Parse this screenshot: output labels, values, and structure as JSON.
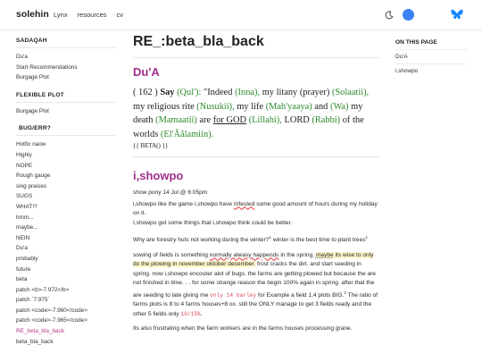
{
  "header": {
    "brand": "solehin",
    "nav": [
      "Lynx",
      "resources",
      "cv"
    ],
    "accent": "#3b82f6"
  },
  "sidebar": {
    "groups": [
      {
        "title": "SADAQAH",
        "items": [
          "Du'a",
          "Start Recommendations",
          "Burgage Plot"
        ]
      },
      {
        "title": "FLEXIBLE PLOT",
        "items": [
          "Burgage Plot"
        ]
      },
      {
        "title": "BUG/ERR?",
        "items": [
          "Hotfix naow",
          "Highly",
          "NOPE",
          "Rough gauge",
          "sing praises",
          "SUGS",
          "WHAT!?",
          "hmm...",
          "maybe...",
          "NEIN",
          "Du'a",
          "probably",
          "future",
          "beta",
          "patch <b>-7.972</b>",
          "patch `7.975`",
          "patch <code>-7.960</code>",
          "patch <code>-7.965</code>",
          "RE_beta_bla_back",
          "beta_bla_back"
        ]
      }
    ],
    "active_item": "RE_beta_bla_back",
    "active_color": "#b5348a"
  },
  "main": {
    "title": "RE_:beta_bla_back",
    "section1": {
      "heading": "Du'A",
      "verse": {
        "num": "( 162 )",
        "say": "Say",
        "qul": "(Qul'):",
        "t1": "\"Indeed",
        "inna": "(Inna),",
        "t2": "my litany (prayer)",
        "solaatii": "(Solaatii),",
        "t3": "my religious rite",
        "nusukii": "(Nusukii),",
        "t4": "my life",
        "mahyaaya": "(Mah'yaaya)",
        "t5": "and",
        "wa": "(Wa)",
        "t6": "my death",
        "mamaatii": "(Mamaatii)",
        "t7": "are",
        "forgod": "for GOD",
        "lillahi": "(Lillahi),",
        "t8": "LORD",
        "rabbi": "(Rabbi)",
        "t9": "of the worlds",
        "alamiin": "(El'Ãâlamiin).",
        "ref": "{{ BETA() }}"
      }
    },
    "section2": {
      "heading": "i,showpo",
      "meta": "show pony 14 Jul @ 6:05pm",
      "p1a": "i,showpo like the game i,showpo have",
      "p1b": "Infested",
      "p1c": "some good amount of hours during my holiday on it.",
      "p1d": "I,showpo got some things that i,showpo think could be better.",
      "p2a": "Why are forestry huts not working during the winter?",
      "fn1": "1",
      "p2b": "winter is the best time to plant trees",
      "fn2": "1",
      "p3a": "sowing of fields is something",
      "p3b": "normally alwasy happends",
      "p3c": "in the spring.",
      "p3d": "maybe",
      "p3e": "its wise to only do the plowing in november oktober december.",
      "p3f": "frost cracks the dirt. and start seeding in spring. now i,showpo encouter alot of bugs. the farms are getting plowed but because the are not finished in time. . . for some strange reason the begin 100% again in spring. after that the are seeding to late giving me",
      "code1": "only 14 barley",
      "p3g": "for Example a field 1,4 plots BIG.",
      "fn3": "2",
      "p3h": "The ratio of farms plots is 8 to 4 farms houses+8 ox. still the ONLY manage to get 3 fields ready and the other 5 fields only",
      "code2": "10/15%",
      "p3i": ".",
      "p4": "Its also frustrating when the farm workers are in the farms houses processing grane."
    }
  },
  "toc": {
    "heading": "ON THIS PAGE",
    "items": [
      "Du'A",
      "i,showpo"
    ]
  }
}
